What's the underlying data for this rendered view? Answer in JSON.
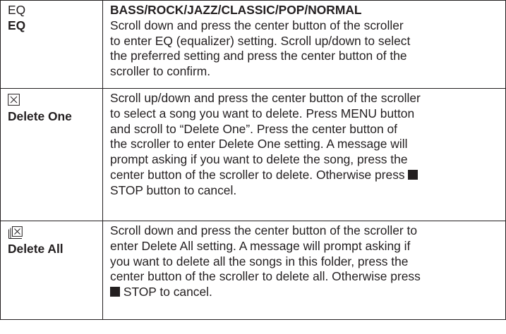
{
  "rows": [
    {
      "glyph": "EQ",
      "name": "EQ",
      "heading": "BASS/ROCK/JAZZ/CLASSIC/POP/NORMAL",
      "lines": [
        "Scroll down and press the center button of the scroller",
        "to enter EQ (equalizer) setting. Scroll up/down to select",
        "the preferred setting and press the center button of the",
        "scroller to confirm."
      ]
    },
    {
      "icon": "delete-one-icon",
      "name": "Delete One",
      "lines": [
        "Scroll up/down and press the center button of the scroller",
        "to select a song you want to delete. Press MENU button",
        "and scroll to “Delete One”. Press the center button of",
        "the scroller to enter Delete One setting. A message will",
        "prompt asking if you want to delete the song, press the",
        "center button of the scroller to delete. Otherwise press"
      ],
      "tail": "STOP button to cancel."
    },
    {
      "icon": "delete-all-icon",
      "name": "Delete All",
      "lines": [
        "Scroll down and press the center button of the scroller to",
        "enter Delete All setting. A message will prompt asking if",
        "you want to delete all the songs in this folder, press the",
        "center button of the scroller to delete all. Otherwise press"
      ],
      "tail": "STOP to cancel."
    }
  ]
}
